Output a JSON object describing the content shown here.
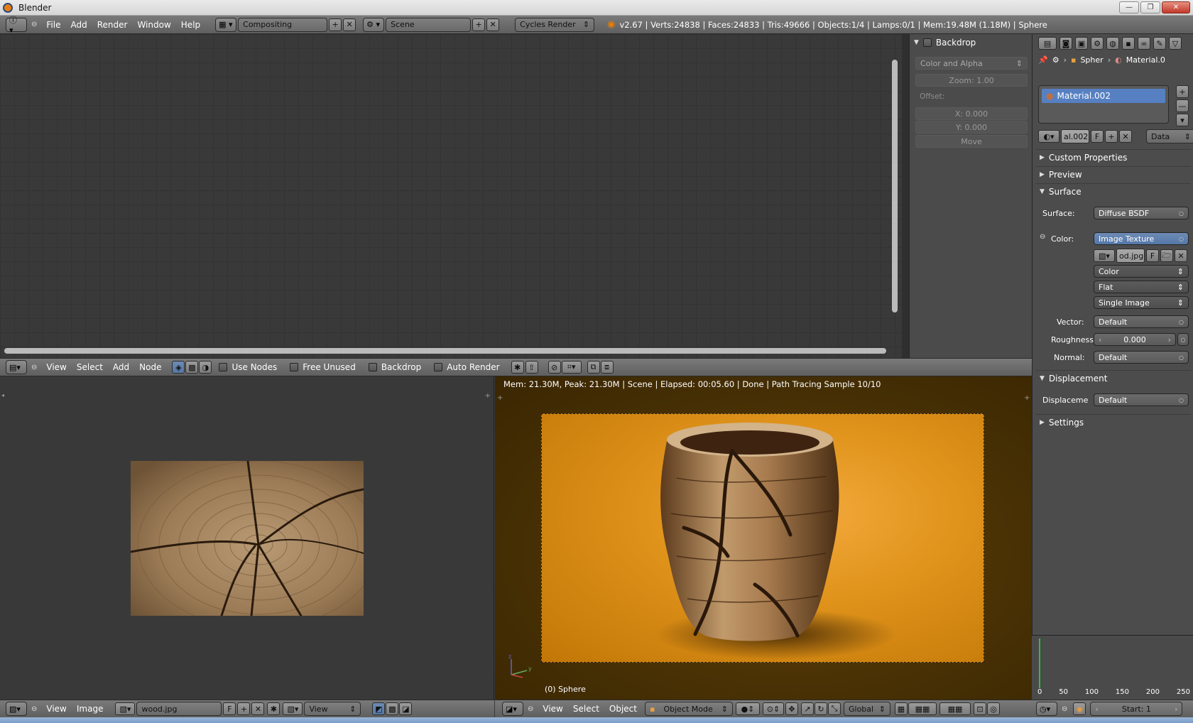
{
  "window": {
    "title": "Blender"
  },
  "top_header": {
    "menus": [
      "File",
      "Add",
      "Render",
      "Window",
      "Help"
    ],
    "screen_layout": "Compositing",
    "scene": "Scene",
    "render_engine": "Cycles Render",
    "stats": "v2.67 | Verts:24838 | Faces:24833 | Tris:49666 | Objects:1/4 | Lamps:0/1 | Mem:19.48M (1.18M) | Sphere"
  },
  "backdrop_panel": {
    "title": "Backdrop",
    "channels": "Color and Alpha",
    "zoom": "Zoom: 1.00",
    "offset_label": "Offset:",
    "x": "X: 0.000",
    "y": "Y: 0.000",
    "move": "Move"
  },
  "properties": {
    "breadcrumb_object": "Spher",
    "breadcrumb_material": "Material.0",
    "material_slot": "Material.002",
    "material_name_short": "al.002",
    "fake_user": "F",
    "link_mode": "Data",
    "sections": {
      "custom_properties": "Custom Properties",
      "preview": "Preview",
      "surface": "Surface",
      "displacement": "Displacement",
      "settings": "Settings"
    },
    "surface": {
      "surface_label": "Surface:",
      "surface_value": "Diffuse BSDF",
      "color_label": "Color:",
      "color_value": "Image Texture",
      "image_name": "od.jpg",
      "image_fake": "F",
      "color_space": "Color",
      "projection": "Flat",
      "source": "Single Image",
      "vector_label": "Vector:",
      "vector_value": "Default",
      "roughness_label": "Roughness",
      "roughness_value": "0.000",
      "normal_label": "Normal:",
      "normal_value": "Default"
    },
    "displacement": {
      "label": "Displaceme",
      "value": "Default"
    }
  },
  "node_editor_header": {
    "menus": [
      "View",
      "Select",
      "Add",
      "Node"
    ],
    "use_nodes": "Use Nodes",
    "free_unused": "Free Unused",
    "backdrop": "Backdrop",
    "auto_render": "Auto Render"
  },
  "image_editor": {
    "menus": [
      "View",
      "Image"
    ],
    "image_name": "wood.jpg",
    "fake_user": "F",
    "view_mode": "View"
  },
  "render_view": {
    "info": "Mem: 21.30M, Peak: 21.30M | Scene | Elapsed: 00:05.60 | Done | Path Tracing Sample 10/10",
    "object_label": "(0) Sphere",
    "menus": [
      "View",
      "Select",
      "Object"
    ],
    "mode": "Object Mode",
    "orientation": "Global"
  },
  "timeline": {
    "ticks": [
      "0",
      "50",
      "100",
      "150",
      "200",
      "250"
    ],
    "start": "Start: 1"
  }
}
